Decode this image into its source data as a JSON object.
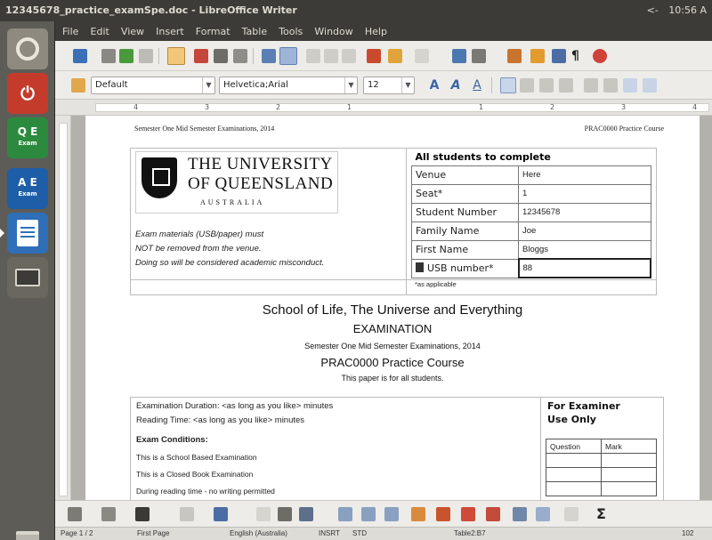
{
  "window": {
    "title": "12345678_practice_examSpe.doc - LibreOffice Writer",
    "tray_lang": "<-",
    "clock": "10:56 A"
  },
  "menu": [
    "File",
    "Edit",
    "View",
    "Insert",
    "Format",
    "Table",
    "Tools",
    "Window",
    "Help"
  ],
  "formatting": {
    "style": "Default",
    "font": "Helvetica;Arial",
    "size": "12"
  },
  "ruler_ticks": [
    "4",
    "3",
    "2",
    "1",
    "1",
    "2",
    "3",
    "4"
  ],
  "document": {
    "header_left": "Semester One Mid Semester Examinations, 2014",
    "header_right": "PRAC0000 Practice Course",
    "university_line1": "THE UNIVERSITY",
    "university_line2": "OF QUEENSLAND",
    "university_line3": "AUSTRALIA",
    "warning": [
      "Exam materials (USB/paper) must",
      "NOT be removed from the venue.",
      "Doing so will be considered academic misconduct."
    ],
    "students_heading": "All students to complete",
    "student_fields": [
      {
        "label": "Venue",
        "value": "Here"
      },
      {
        "label": "Seat*",
        "value": "1"
      },
      {
        "label": "Student Number",
        "value": "12345678"
      },
      {
        "label": "Family Name",
        "value": "Joe"
      },
      {
        "label": "First Name",
        "value": "Bloggs"
      },
      {
        "label": "USB number*",
        "value": "88"
      }
    ],
    "applicable_note": "*as applicable",
    "school": "School of Life, The Universe and Everything",
    "exam_title": "EXAMINATION",
    "semester": "Semester One Mid Semester Examinations, 2014",
    "course": "PRAC0000 Practice Course",
    "paper_note": "This paper is for all students.",
    "duration": "Examination Duration: <as long as you like> minutes",
    "reading_time": "Reading Time: <as long as you like> minutes",
    "conditions_heading": "Exam Conditions:",
    "conditions": [
      "This is a School Based Examination",
      "This is a Closed Book Examination",
      "During reading time - no writing permitted"
    ],
    "examiner_line1": "For Examiner",
    "examiner_line2": "Use Only",
    "question_col": "Question",
    "mark_col": "Mark"
  },
  "status": {
    "page": "Page 1 / 2",
    "page_style": "First Page",
    "language": "English (Australia)",
    "mode": "INSRT",
    "selection": "STD",
    "table_cell": "Table2:B7",
    "zoom": "102"
  },
  "icons": [
    "dash-icon",
    "power-icon",
    "qe-app-icon",
    "ae-app-icon",
    "writer-icon",
    "terminal-icon",
    "trash-icon",
    "sum-icon"
  ]
}
